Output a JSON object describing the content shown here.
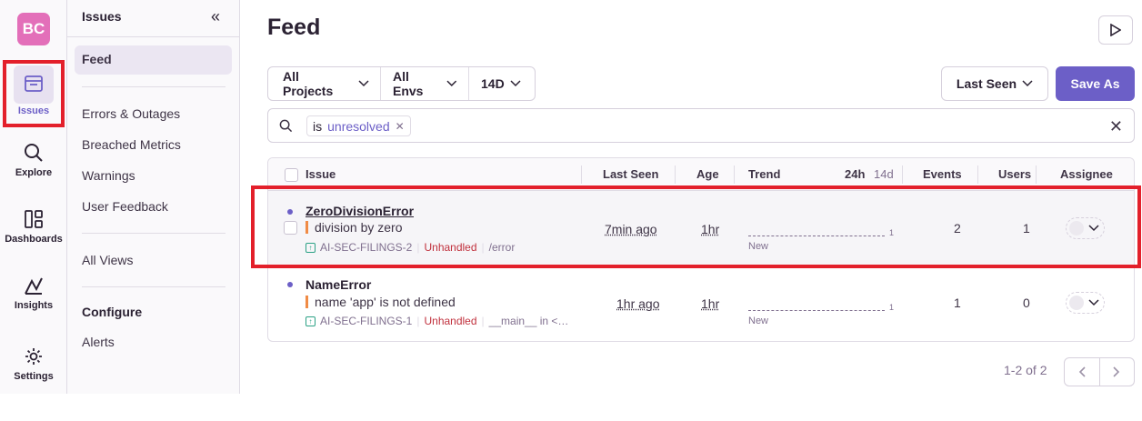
{
  "org": {
    "initials": "BC"
  },
  "rail": [
    {
      "label": "Issues",
      "icon": "issues-inbox-icon",
      "active": true
    },
    {
      "label": "Explore",
      "icon": "search-icon"
    },
    {
      "label": "Dashboards",
      "icon": "dashboards-icon"
    },
    {
      "label": "Insights",
      "icon": "insights-icon"
    },
    {
      "label": "Settings",
      "icon": "gear-icon"
    }
  ],
  "sidebar": {
    "title": "Issues",
    "feed": "Feed",
    "links": [
      "Errors & Outages",
      "Breached Metrics",
      "Warnings",
      "User Feedback"
    ],
    "all_views": "All Views",
    "configure": "Configure",
    "alerts": "Alerts"
  },
  "main": {
    "title": "Feed",
    "filters": {
      "projects": "All Projects",
      "envs": "All Envs",
      "period": "14D"
    },
    "sort": "Last Seen",
    "save_as": "Save As",
    "search": {
      "key": "is",
      "value": "unresolved"
    }
  },
  "table": {
    "headers": {
      "issue": "Issue",
      "last_seen": "Last Seen",
      "age": "Age",
      "trend": "Trend",
      "trend_24h": "24h",
      "trend_14d": "14d",
      "events": "Events",
      "users": "Users",
      "assignee": "Assignee"
    },
    "rows": [
      {
        "title": "ZeroDivisionError",
        "message": "division by zero",
        "project": "AI-SEC-FILINGS-2",
        "status": "Unhandled",
        "culprit": "/error",
        "last_seen": "7min ago",
        "age": "1hr",
        "trend_max": "1",
        "trend_label": "New",
        "events": "2",
        "users": "1"
      },
      {
        "title": "NameError",
        "message": "name 'app' is not defined",
        "project": "AI-SEC-FILINGS-1",
        "status": "Unhandled",
        "culprit": "__main__ in <…",
        "last_seen": "1hr ago",
        "age": "1hr",
        "trend_max": "1",
        "trend_label": "New",
        "events": "1",
        "users": "0"
      }
    ]
  },
  "pagination": {
    "text": "1-2 of 2"
  }
}
